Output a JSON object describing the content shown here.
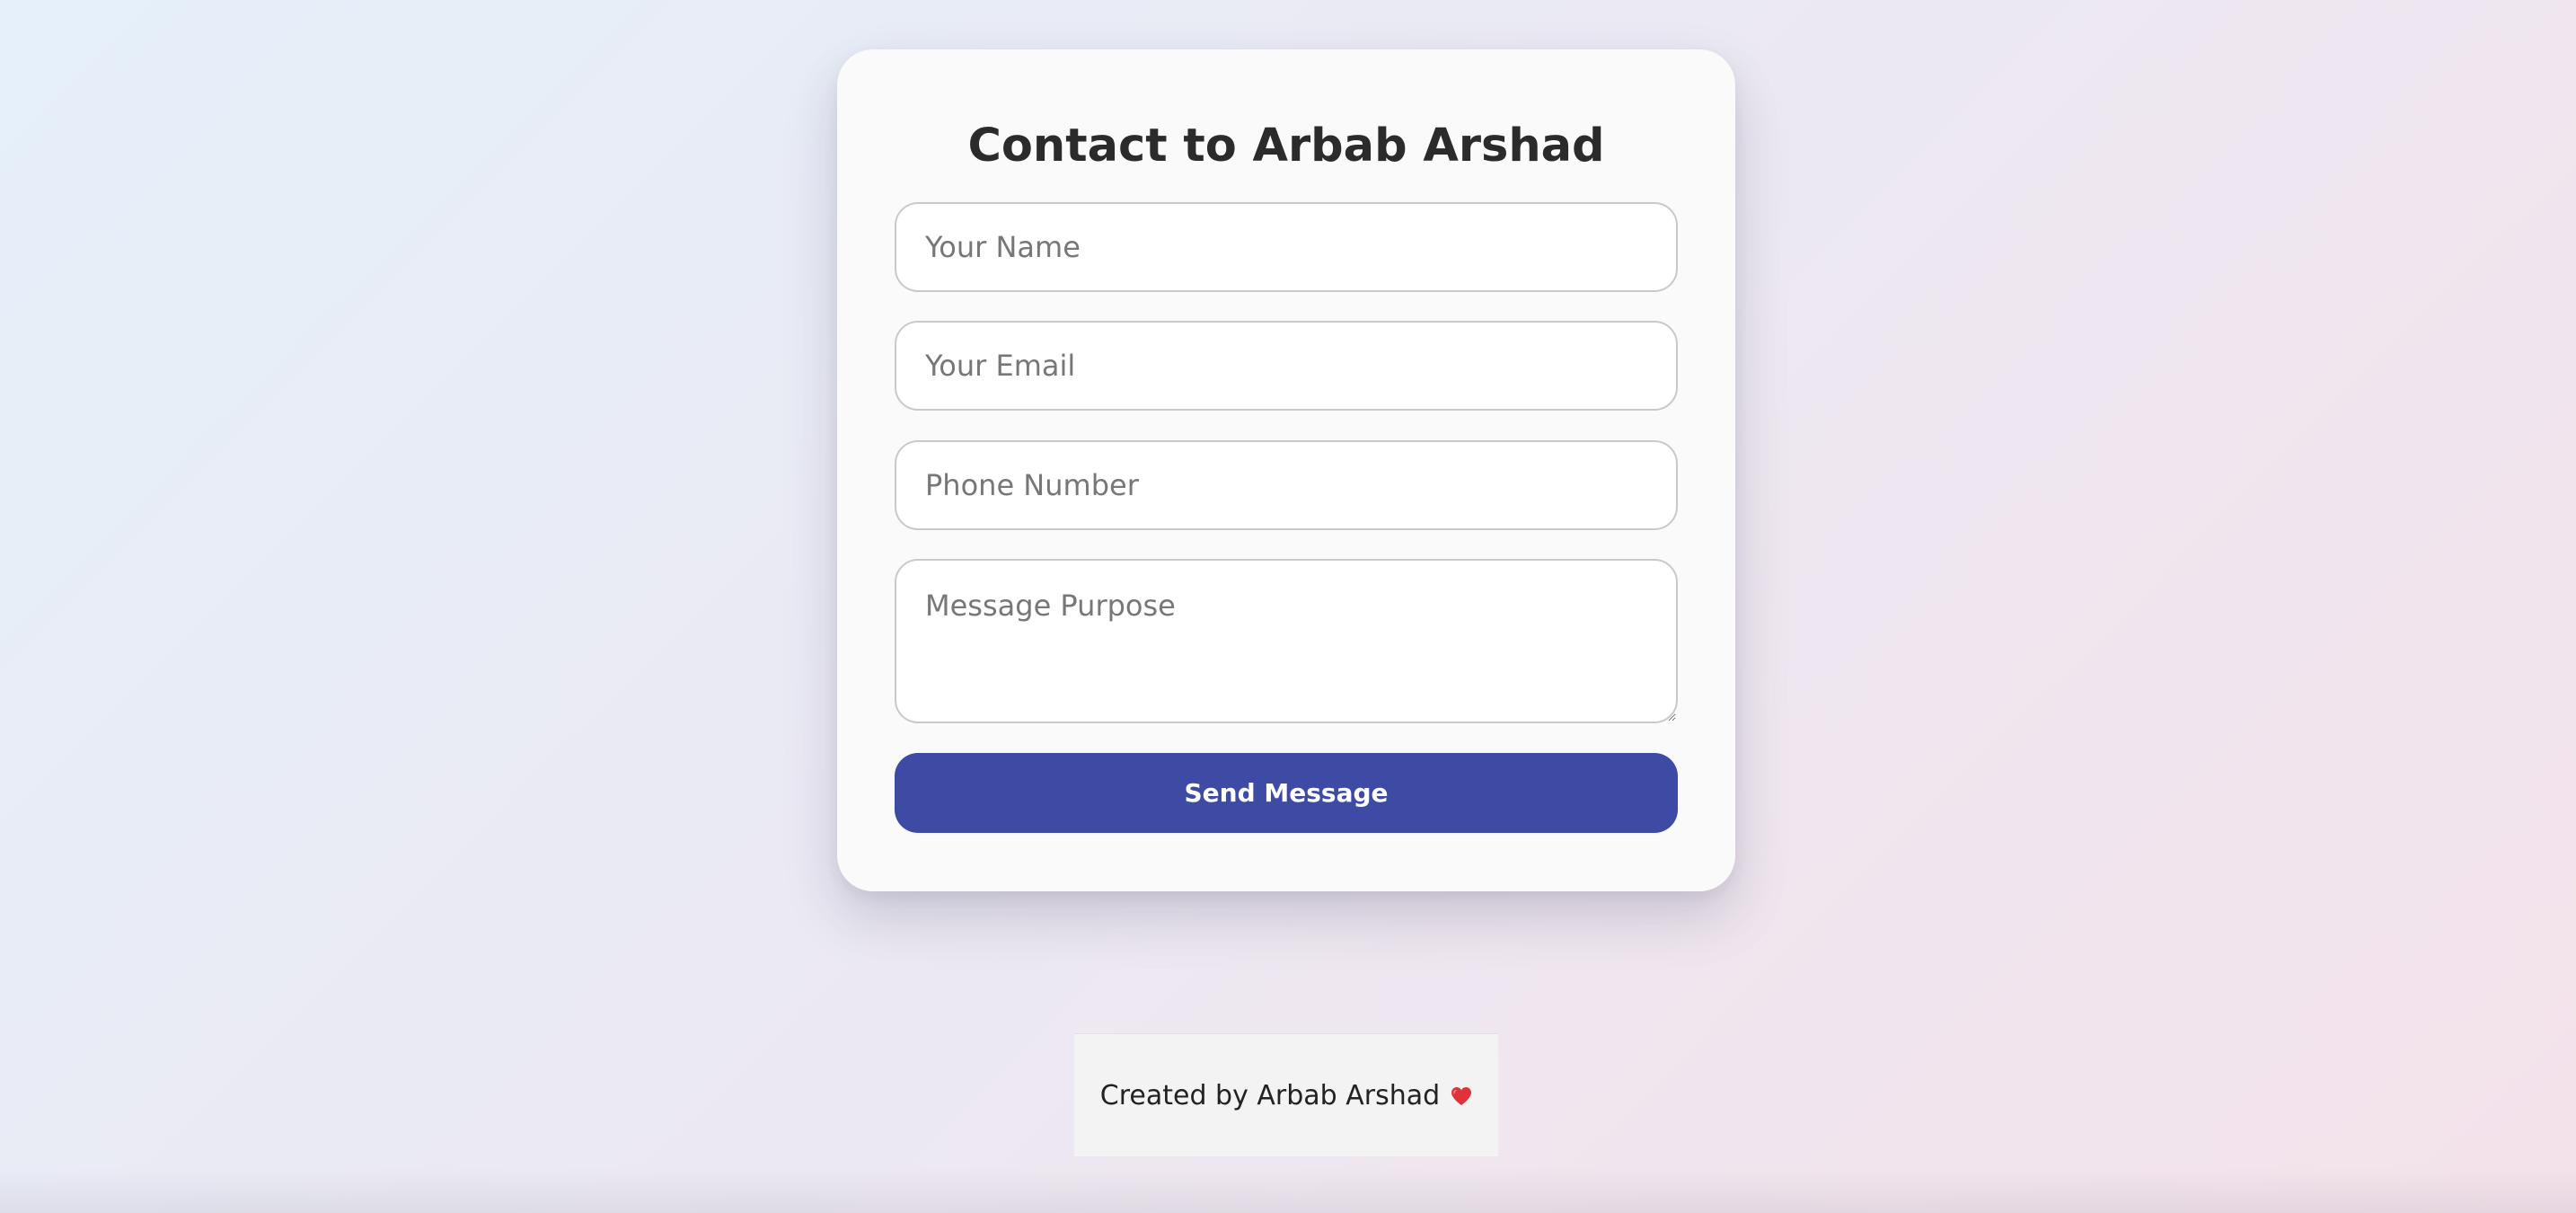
{
  "form": {
    "title": "Contact to Arbab Arshad",
    "name_placeholder": "Your Name",
    "name_value": "",
    "email_placeholder": "Your Email",
    "email_value": "",
    "phone_placeholder": "Phone Number",
    "phone_value": "",
    "message_placeholder": "Message Purpose",
    "message_value": "",
    "submit_label": "Send Message"
  },
  "footer": {
    "text": "Created by Arbab Arshad",
    "icon": "heart-icon"
  },
  "colors": {
    "button": "#3e4ba5",
    "heart": "#e0323a"
  }
}
